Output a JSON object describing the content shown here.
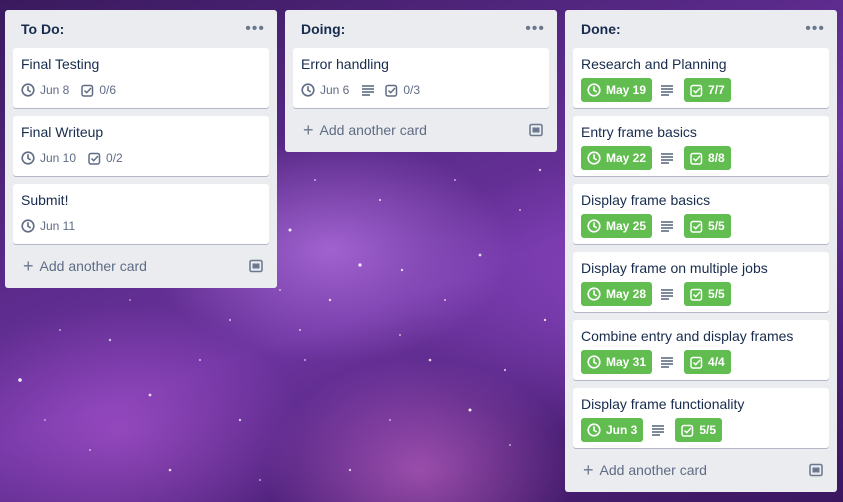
{
  "lists": [
    {
      "title": "To Do:",
      "cards": [
        {
          "title": "Final Testing",
          "due": "Jun 8",
          "checklist": "0/6"
        },
        {
          "title": "Final Writeup",
          "due": "Jun 10",
          "checklist": "0/2"
        },
        {
          "title": "Submit!",
          "due": "Jun 11"
        }
      ],
      "add_label": "Add another card"
    },
    {
      "title": "Doing:",
      "cards": [
        {
          "title": "Error handling",
          "due": "Jun 6",
          "checklist": "0/3",
          "has_description": true
        }
      ],
      "add_label": "Add another card"
    },
    {
      "title": "Done:",
      "cards": [
        {
          "title": "Research and Planning",
          "due": "May 19",
          "checklist": "7/7",
          "has_description": true,
          "complete": true
        },
        {
          "title": "Entry frame basics",
          "due": "May 22",
          "checklist": "8/8",
          "has_description": true,
          "complete": true
        },
        {
          "title": "Display frame basics",
          "due": "May 25",
          "checklist": "5/5",
          "has_description": true,
          "complete": true
        },
        {
          "title": "Display frame on multiple jobs",
          "due": "May 28",
          "checklist": "5/5",
          "has_description": true,
          "complete": true
        },
        {
          "title": "Combine entry and display frames",
          "due": "May 31",
          "checklist": "4/4",
          "has_description": true,
          "complete": true
        },
        {
          "title": "Display frame functionality",
          "due": "Jun 3",
          "checklist": "5/5",
          "has_description": true,
          "complete": true
        }
      ],
      "add_label": "Add another card"
    }
  ],
  "colors": {
    "complete_badge": "#61bd4f",
    "list_bg": "#ebecf0"
  },
  "icons": {
    "due": "clock-icon",
    "checklist": "checkbox-icon",
    "description": "description-icon",
    "menu": "more-icon",
    "template": "card-template-icon"
  }
}
